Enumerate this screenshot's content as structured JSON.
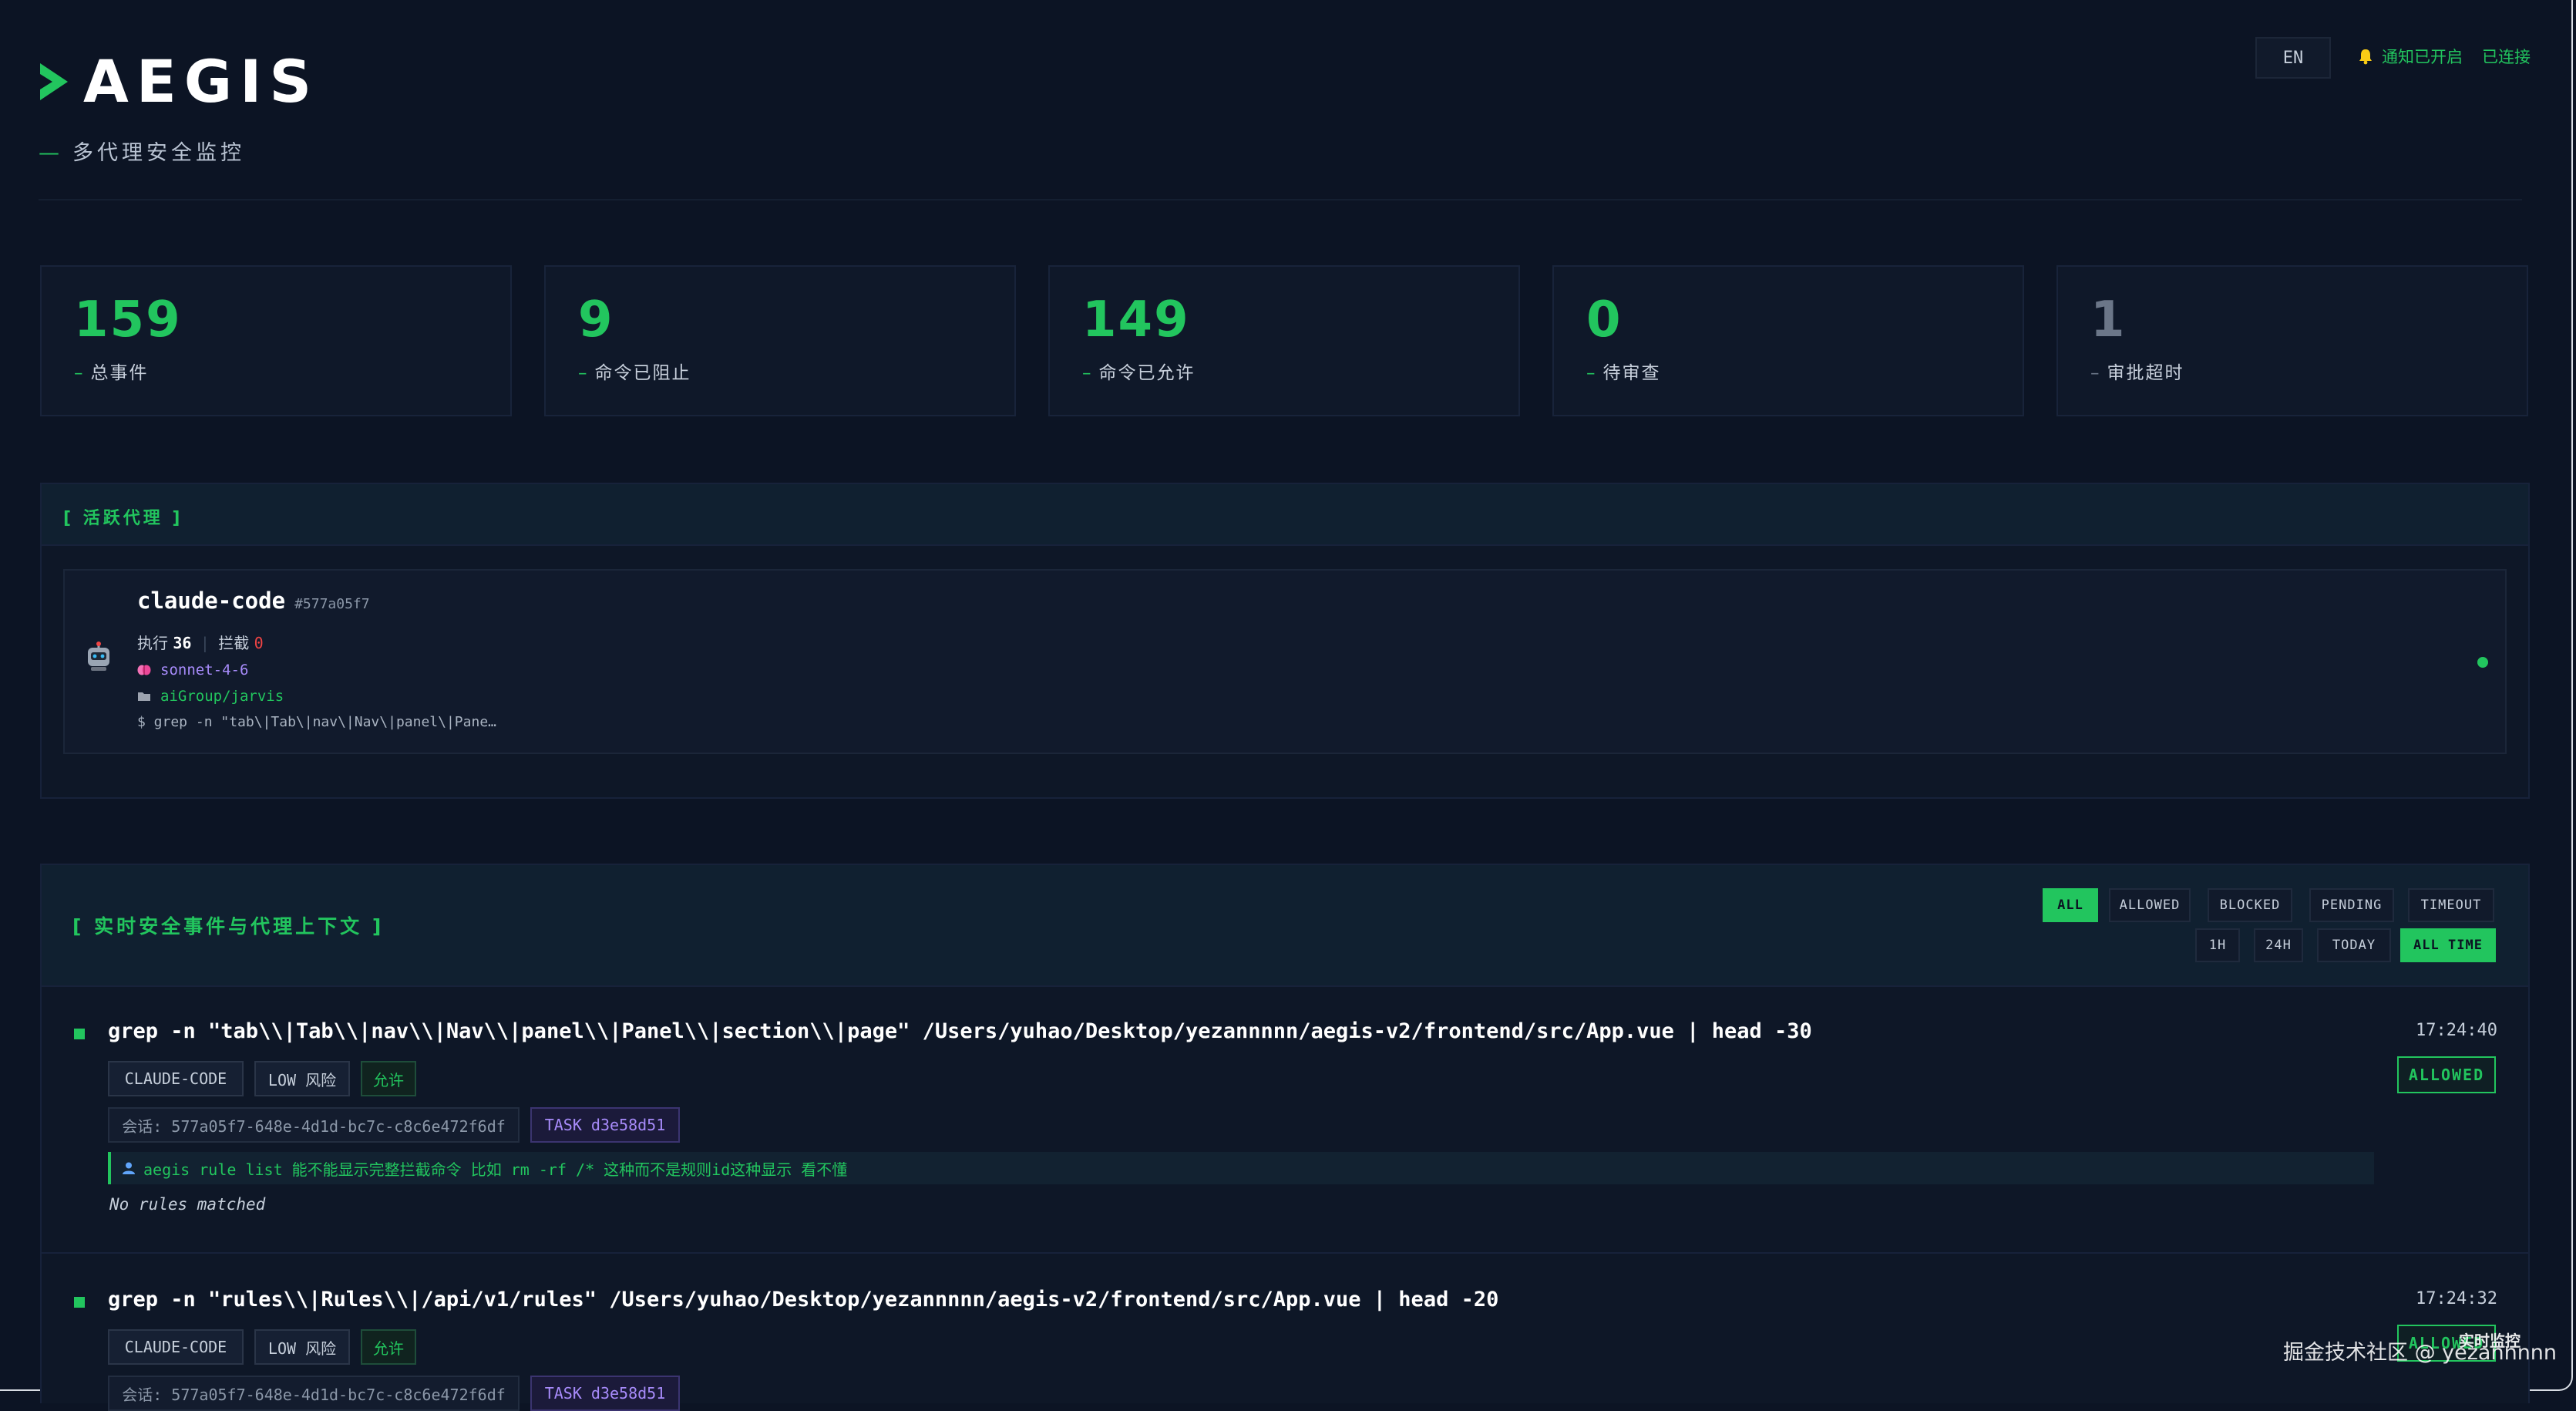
{
  "header": {
    "logo_text": "AEGIS",
    "subtitle": "多代理安全监控",
    "subtitle_dash": "—",
    "lang_button": "EN",
    "notify_status": "通知已开启",
    "connection_status": "已连接"
  },
  "stats": [
    {
      "value": "159",
      "label": "总事件"
    },
    {
      "value": "9",
      "label": "命令已阻止"
    },
    {
      "value": "149",
      "label": "命令已允许"
    },
    {
      "value": "0",
      "label": "待审查"
    },
    {
      "value": "1",
      "label": "审批超时"
    }
  ],
  "agents_panel": {
    "title": "[ 活跃代理 ]",
    "agent": {
      "name": "claude-code",
      "hash": "#577a05f7",
      "exec_label": "执行",
      "exec_count": "36",
      "block_label": "拦截",
      "block_count": "0",
      "model": "sonnet-4-6",
      "project": "aiGroup/jarvis",
      "last_command": "$ grep -n \"tab\\|Tab\\|nav\\|Nav\\|panel\\|Pane…"
    }
  },
  "events_panel": {
    "title": "[ 实时安全事件与代理上下文 ]",
    "type_filters": [
      "ALL",
      "ALLOWED",
      "BLOCKED",
      "PENDING",
      "TIMEOUT"
    ],
    "active_type_filter": "ALL",
    "time_filters": [
      "1H",
      "24H",
      "TODAY",
      "ALL TIME"
    ],
    "active_time_filter": "ALL TIME",
    "events": [
      {
        "command": "grep -n \"tab\\\\|Tab\\\\|nav\\\\|Nav\\\\|panel\\\\|Panel\\\\|section\\\\|page\" /Users/yuhao/Desktop/yezannnnn/aegis-v2/frontend/src/App.vue | head -30",
        "time": "17:24:40",
        "status": "ALLOWED",
        "agent_tag": "CLAUDE-CODE",
        "risk_tag": "LOW 风险",
        "decision_tag": "允许",
        "session": "会话: 577a05f7-648e-4d1d-bc7c-c8c6e472f6df",
        "task": "TASK d3e58d51",
        "context": "aegis rule list 能不能显示完整拦截命令 比如 rm -rf /* 这种而不是规则id这种显示 看不懂",
        "rules": "No rules matched"
      },
      {
        "command": "grep -n \"rules\\\\|Rules\\\\|/api/v1/rules\" /Users/yuhao/Desktop/yezannnnn/aegis-v2/frontend/src/App.vue | head -20",
        "time": "17:24:32",
        "status": "ALLOWED",
        "agent_tag": "CLAUDE-CODE",
        "risk_tag": "LOW 风险",
        "decision_tag": "允许",
        "session": "会话: 577a05f7-648e-4d1d-bc7c-c8c6e472f6df",
        "task": "TASK d3e58d51"
      }
    ]
  },
  "overlay": {
    "floating_label": "实时监控",
    "watermark": "掘金技术社区 @ yezannnnn"
  },
  "colors": {
    "background": "#0c1424",
    "accent": "#22c55e",
    "danger": "#ef4444",
    "model": "#a78bfa"
  },
  "icons": [
    "caret-logo-icon",
    "bell-icon",
    "robot-icon",
    "brain-icon",
    "folder-icon",
    "user-icon"
  ]
}
